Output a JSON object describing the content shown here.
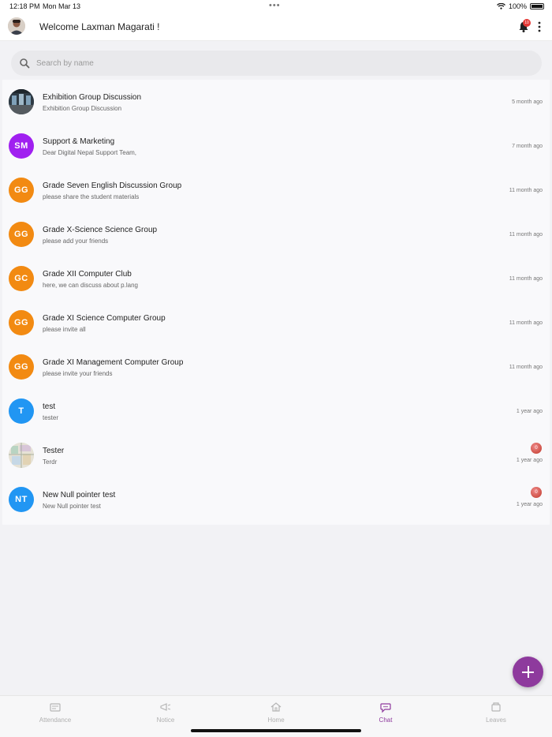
{
  "status_bar": {
    "time": "12:18 PM",
    "date": "Mon Mar 13",
    "battery": "100%"
  },
  "header": {
    "welcome": "Welcome Laxman Magarati !",
    "notification_count": "10"
  },
  "search": {
    "placeholder": "Search by name"
  },
  "chats": [
    {
      "initials": "",
      "avatar": "photo-hall",
      "color": "#3a4a5a",
      "title": "Exhibition Group Discussion",
      "subtitle": "Exhibition Group Discussion",
      "time": "5 month ago",
      "unread": ""
    },
    {
      "initials": "SM",
      "avatar": "initials",
      "color": "#a020f0",
      "title": "Support & Marketing",
      "subtitle": "Dear Digital Nepal Support Team,",
      "time": "7 month ago",
      "unread": ""
    },
    {
      "initials": "GG",
      "avatar": "initials",
      "color": "#f28a12",
      "title": "Grade Seven English Discussion Group",
      "subtitle": "please share the student materials",
      "time": "11 month ago",
      "unread": ""
    },
    {
      "initials": "GG",
      "avatar": "initials",
      "color": "#f28a12",
      "title": "Grade X-Science Science Group",
      "subtitle": "please add your friends",
      "time": "11 month ago",
      "unread": ""
    },
    {
      "initials": "GC",
      "avatar": "initials",
      "color": "#f28a12",
      "title": "Grade XII Computer Club",
      "subtitle": "here, we can discuss about p.lang",
      "time": "11 month ago",
      "unread": ""
    },
    {
      "initials": "GG",
      "avatar": "initials",
      "color": "#f28a12",
      "title": "Grade XI Science Computer Group",
      "subtitle": "please invite all",
      "time": "11 month ago",
      "unread": ""
    },
    {
      "initials": "GG",
      "avatar": "initials",
      "color": "#f28a12",
      "title": "Grade XI Management Computer Group",
      "subtitle": "please invite your friends",
      "time": "11 month ago",
      "unread": ""
    },
    {
      "initials": "T",
      "avatar": "initials",
      "color": "#2196f3",
      "title": "test",
      "subtitle": "tester",
      "time": "1 year ago",
      "unread": ""
    },
    {
      "initials": "",
      "avatar": "photo-map",
      "color": "#cfd8c8",
      "title": "Tester",
      "subtitle": "Terdr",
      "time": "1 year ago",
      "unread": "0"
    },
    {
      "initials": "NT",
      "avatar": "initials",
      "color": "#2196f3",
      "title": "New Null pointer test",
      "subtitle": "New Null pointer test",
      "time": "1 year ago",
      "unread": "0"
    }
  ],
  "tabs": [
    {
      "label": "Attendance",
      "icon": "attendance-icon",
      "active": false
    },
    {
      "label": "Notice",
      "icon": "megaphone-icon",
      "active": false
    },
    {
      "label": "Home",
      "icon": "home-icon",
      "active": false
    },
    {
      "label": "Chat",
      "icon": "chat-icon",
      "active": true
    },
    {
      "label": "Leaves",
      "icon": "leaves-icon",
      "active": false
    }
  ],
  "colors": {
    "accent": "#8e3a9d",
    "badge": "#e53935"
  }
}
